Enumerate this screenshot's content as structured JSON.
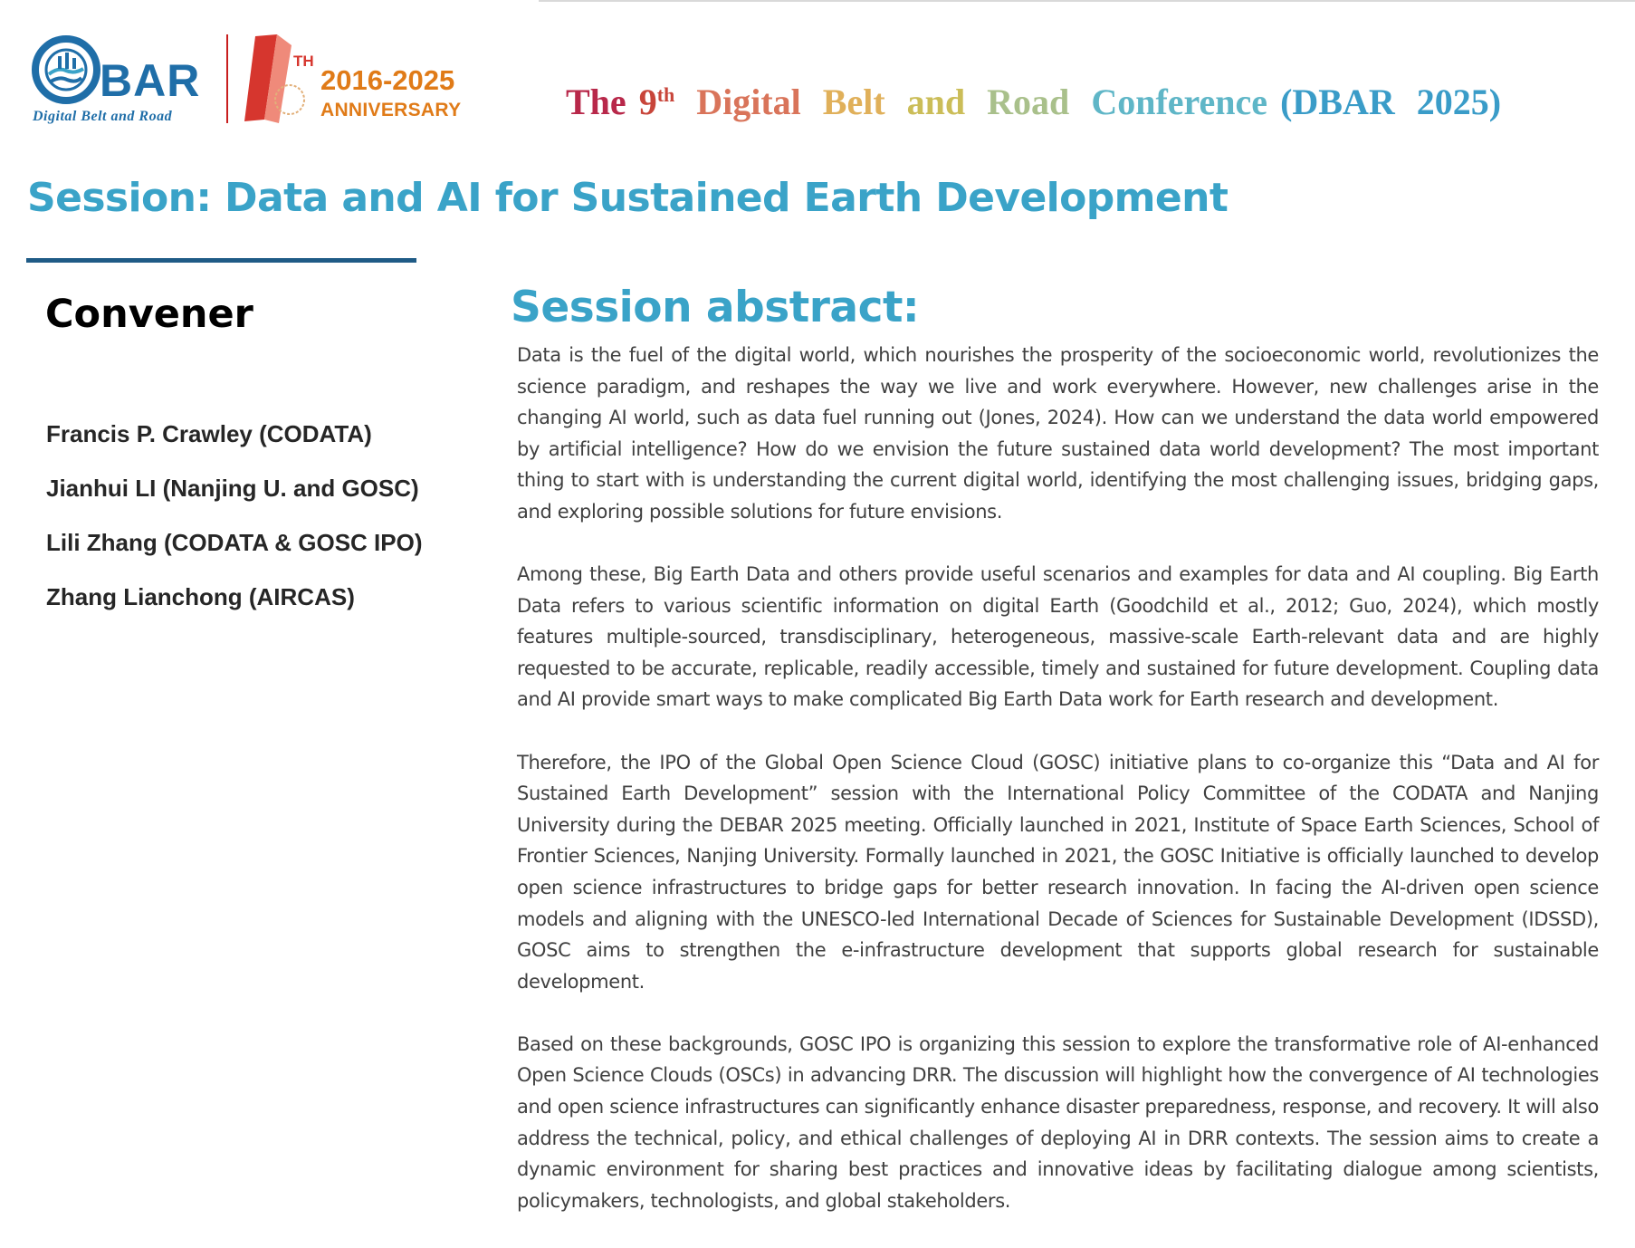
{
  "header": {
    "logo": {
      "wordmark": "BAR",
      "subtitle": "Digital Belt and Road"
    },
    "anniversary": {
      "number": "1",
      "ordinal": "TH",
      "years": "2016-2025",
      "label": "ANNIVERSARY"
    },
    "conference_title": {
      "words": [
        {
          "text": "The",
          "color": "#b8284a"
        },
        {
          "text": "Digital",
          "color": "#d9745a"
        },
        {
          "text": "Belt",
          "color": "#e0b05a"
        },
        {
          "text": "and",
          "color": "#cbbd58"
        },
        {
          "text": "Road",
          "color": "#a9c08b"
        },
        {
          "text": "Conference",
          "color": "#5fb6c7"
        },
        {
          "text": "(DBAR",
          "color": "#3a9cc8"
        },
        {
          "text": "2025)",
          "color": "#3a9cc8"
        }
      ],
      "ordinal_number": "9",
      "ordinal_suffix": "th",
      "ordinal_color": "#c8453a"
    }
  },
  "session_title": "Session: Data and AI for Sustained Earth Development",
  "convener": {
    "heading": "Convener",
    "names": [
      "Francis P. Crawley (CODATA)",
      "Jianhui LI (Nanjing U. and GOSC)",
      "Lili Zhang (CODATA & GOSC IPO)",
      "Zhang Lianchong (AIRCAS)"
    ]
  },
  "abstract": {
    "heading": "Session abstract:",
    "paragraphs": [
      "Data is the fuel of the digital world, which nourishes the prosperity of the socioeconomic world, revolutionizes the science paradigm, and reshapes the way we live and work everywhere. However, new challenges arise in the changing AI world, such as data fuel running out (Jones, 2024). How can we understand the data world empowered by artificial intelligence? How do we envision the future sustained data world development? The most important thing to start with is understanding the current digital world, identifying the most challenging issues, bridging gaps, and exploring possible solutions for future envisions.",
      "Among these, Big Earth Data and others provide useful scenarios and examples for data and AI coupling. Big Earth Data refers to various scientific information on digital Earth (Goodchild et al., 2012; Guo, 2024), which mostly features multiple-sourced, transdisciplinary, heterogeneous, massive-scale Earth-relevant data and are highly requested to be accurate, replicable, readily accessible, timely and sustained for future development. Coupling data and AI provide smart ways to make complicated Big Earth Data work for Earth research and development.",
      "Therefore, the IPO of the Global Open Science Cloud (GOSC) initiative plans to co-organize this “Data and AI for Sustained Earth Development” session with the International Policy Committee of the CODATA and Nanjing University during the DEBAR 2025 meeting. Officially launched in 2021, Institute of Space Earth Sciences, School of Frontier Sciences, Nanjing University. Formally launched in 2021, the GOSC Initiative is officially launched to develop open science infrastructures to bridge gaps for better research innovation. In facing the AI-driven open science models and aligning with the UNESCO-led International Decade of Sciences for Sustainable Development (IDSSD), GOSC aims to strengthen the e-infrastructure development that supports global research for sustainable development.",
      "Based on these backgrounds, GOSC IPO is organizing this session to explore the transformative role of AI-enhanced Open Science Clouds (OSCs) in advancing DRR. The discussion will highlight how the convergence of AI technologies and open science infrastructures can significantly enhance disaster preparedness, response, and recovery. It will also address the technical, policy, and ethical challenges of deploying AI in DRR contexts. The session aims to create a dynamic environment for sharing best practices and innovative ideas by facilitating dialogue among scientists, policymakers, technologists, and global stakeholders."
    ]
  },
  "colors": {
    "accent": "#3aa3c8",
    "rule": "#1f5b86",
    "logo_blue": "#1f6ea8",
    "anniversary_orange": "#e07b18",
    "anniversary_red": "#d6362e"
  }
}
